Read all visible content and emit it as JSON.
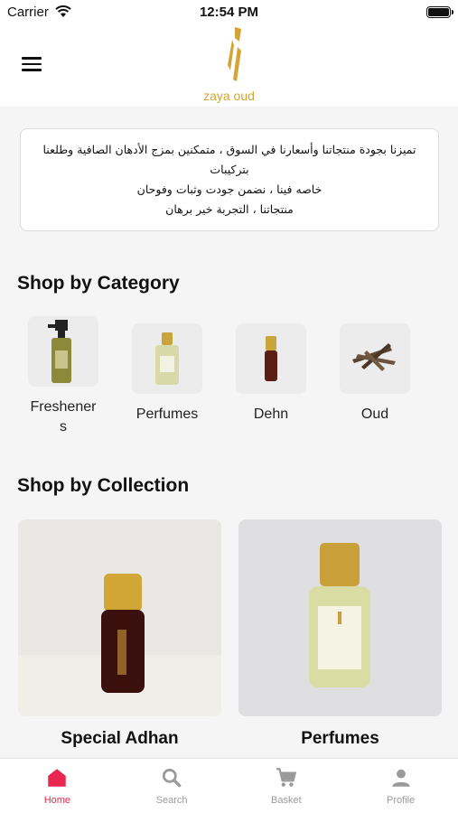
{
  "status_bar": {
    "carrier": "Carrier",
    "time": "12:54 PM"
  },
  "header": {
    "logo_text": "zaya oud"
  },
  "intro": {
    "text_line1": "تميزنا بجودة منتجاتنا وأسعارنا في السوق ، متمكنين بمزج الأدهان الصافية وطلعنا بتركيبات",
    "text_line2": "خاصه فينا ، نضمن جودت وثبات وفوحان",
    "text_line3": "منتجاتنا ، التجربة خير برهان"
  },
  "shop_by_category": {
    "title": "Shop by Category",
    "items": [
      {
        "label_line1": "Freshener",
        "label_line2": "s",
        "icon": "spray-bottle-image"
      },
      {
        "label_line1": "Perfumes",
        "icon": "perfume-bottle-image"
      },
      {
        "label_line1": "Dehn",
        "icon": "dehn-vial-image"
      },
      {
        "label_line1": "Oud",
        "icon": "oud-wood-image"
      }
    ]
  },
  "shop_by_collection": {
    "title": "Shop by Collection",
    "items": [
      {
        "label": "Special Adhan",
        "icon": "special-adhan-image"
      },
      {
        "label": "Perfumes",
        "icon": "perfumes-collection-image"
      }
    ]
  },
  "tab_bar": {
    "tabs": [
      {
        "label": "Home",
        "icon": "home-icon",
        "active": true
      },
      {
        "label": "Search",
        "icon": "search-icon",
        "active": false
      },
      {
        "label": "Basket",
        "icon": "cart-icon",
        "active": false
      },
      {
        "label": "Profile",
        "icon": "profile-icon",
        "active": false
      }
    ]
  },
  "colors": {
    "accent": "#e8264f",
    "brand_gold": "#d4a437",
    "inactive_tab": "#9a9a9a"
  }
}
